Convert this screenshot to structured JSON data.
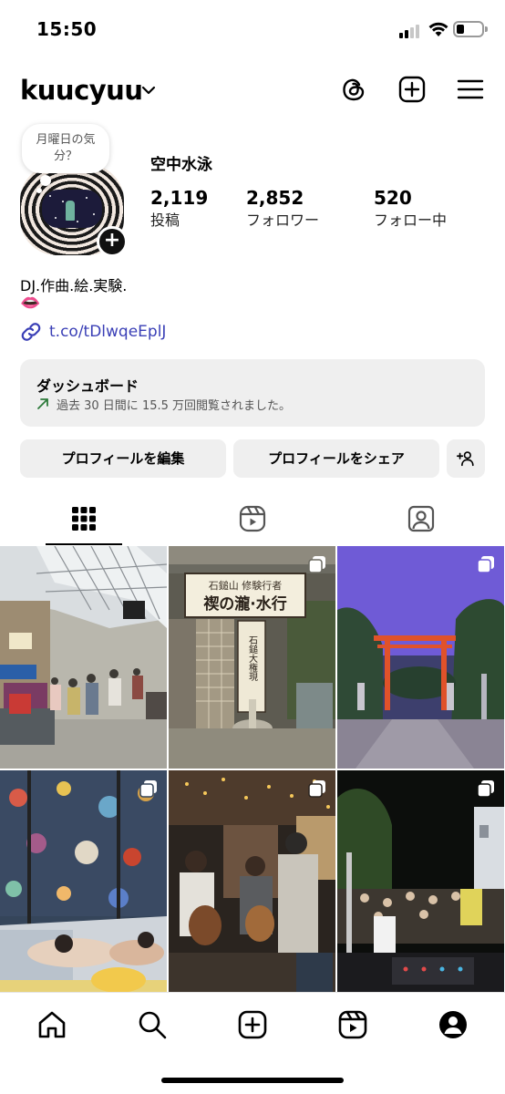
{
  "status_bar": {
    "time": "15:50"
  },
  "header": {
    "username": "kuucyuu"
  },
  "profile": {
    "note": "月曜日の気分？",
    "display_name": "空中水泳",
    "stats": [
      {
        "value": "2,119",
        "label": "投稿"
      },
      {
        "value": "2,852",
        "label": "フォロワー"
      },
      {
        "value": "520",
        "label": "フォロー中"
      }
    ],
    "bio_line1": "DJ.作曲.絵.実験.",
    "bio_line2": "👄",
    "link": "t.co/tDlwqeEplJ"
  },
  "dashboard": {
    "title": "ダッシュボード",
    "subtitle": "過去 30 日間に 15.5 万回閲覧されました。"
  },
  "actions": {
    "edit_label": "プロフィールを編集",
    "share_label": "プロフィールをシェア"
  },
  "icons": {
    "chevron": "chevron-down-icon",
    "threads": "threads-icon",
    "create": "plus-square-icon",
    "menu": "hamburger-menu-icon",
    "link": "link-icon",
    "trend": "trend-up-arrow-icon",
    "add_person": "add-person-icon",
    "grid_tab": "grid-icon",
    "reels_tab": "reels-icon",
    "tagged_tab": "tagged-person-icon",
    "multi_post": "multiple-photos-icon",
    "home": "home-icon",
    "search": "search-icon",
    "profile": "profile-icon"
  },
  "colors": {
    "link": "#3a3fb6",
    "button_bg": "#efefef",
    "trend": "#2c7a3a"
  },
  "posts": [
    {
      "scene": "shopping arcade crowd"
    },
    {
      "scene": "shrine waterfall signboard"
    },
    {
      "scene": "torii gate at dusk"
    },
    {
      "scene": "children sleeping by mural"
    },
    {
      "scene": "guitar players at night"
    },
    {
      "scene": "outdoor night concert crowd"
    }
  ],
  "post_signs": {
    "top": "石鎚山 修験行者",
    "main": "禊の瀧·水行",
    "pillar": "石鎚大権現"
  }
}
